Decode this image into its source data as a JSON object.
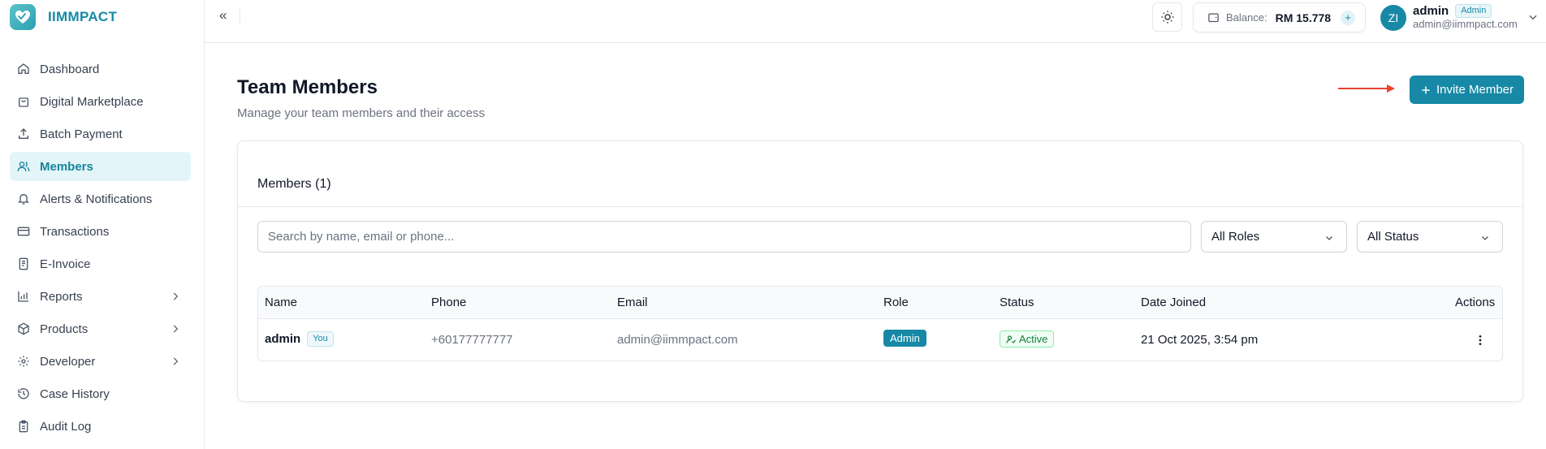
{
  "app": {
    "name": "IIMMPACT"
  },
  "sidebar": {
    "items": [
      {
        "label": "Dashboard",
        "icon": "home-icon"
      },
      {
        "label": "Digital Marketplace",
        "icon": "shopping-bag-icon"
      },
      {
        "label": "Batch Payment",
        "icon": "upload-icon"
      },
      {
        "label": "Members",
        "icon": "users-icon",
        "active": true
      },
      {
        "label": "Alerts & Notifications",
        "icon": "bell-icon"
      },
      {
        "label": "Transactions",
        "icon": "credit-card-icon"
      },
      {
        "label": "E-Invoice",
        "icon": "receipt-icon"
      },
      {
        "label": "Reports",
        "icon": "bar-chart-icon",
        "expandable": true
      },
      {
        "label": "Products",
        "icon": "package-icon",
        "expandable": true
      },
      {
        "label": "Developer",
        "icon": "gear-icon",
        "expandable": true
      },
      {
        "label": "Case History",
        "icon": "history-icon"
      },
      {
        "label": "Audit Log",
        "icon": "clipboard-icon"
      }
    ]
  },
  "topbar": {
    "collapse_glyph": "«",
    "balance_label": "Balance:",
    "balance_value": "RM 15.778",
    "balance_add": "+",
    "user": {
      "initials": "ZI",
      "name": "admin",
      "role": "Admin",
      "email": "admin@iimmpact.com"
    }
  },
  "main": {
    "title": "Team Members",
    "subtitle": "Manage your team members and their access",
    "invite_label": "Invite Member",
    "members_heading": "Members (1)",
    "search_placeholder": "Search by name, email or phone...",
    "roles_filter": "All Roles",
    "status_filter": "All Status",
    "table": {
      "headers": [
        "Name",
        "Phone",
        "Email",
        "Role",
        "Status",
        "Date Joined",
        "Actions"
      ],
      "rows": [
        {
          "name": "admin",
          "badge": "You",
          "phone": "+60177777777",
          "email": "admin@iimmpact.com",
          "role": "Admin",
          "status": "Active",
          "date_joined": "21 Oct 2025, 3:54 pm"
        }
      ]
    }
  },
  "colors": {
    "accent": "#1789a6",
    "active_bg": "#e3f5f8",
    "success": "#15803d",
    "arrow": "#e8442c"
  }
}
